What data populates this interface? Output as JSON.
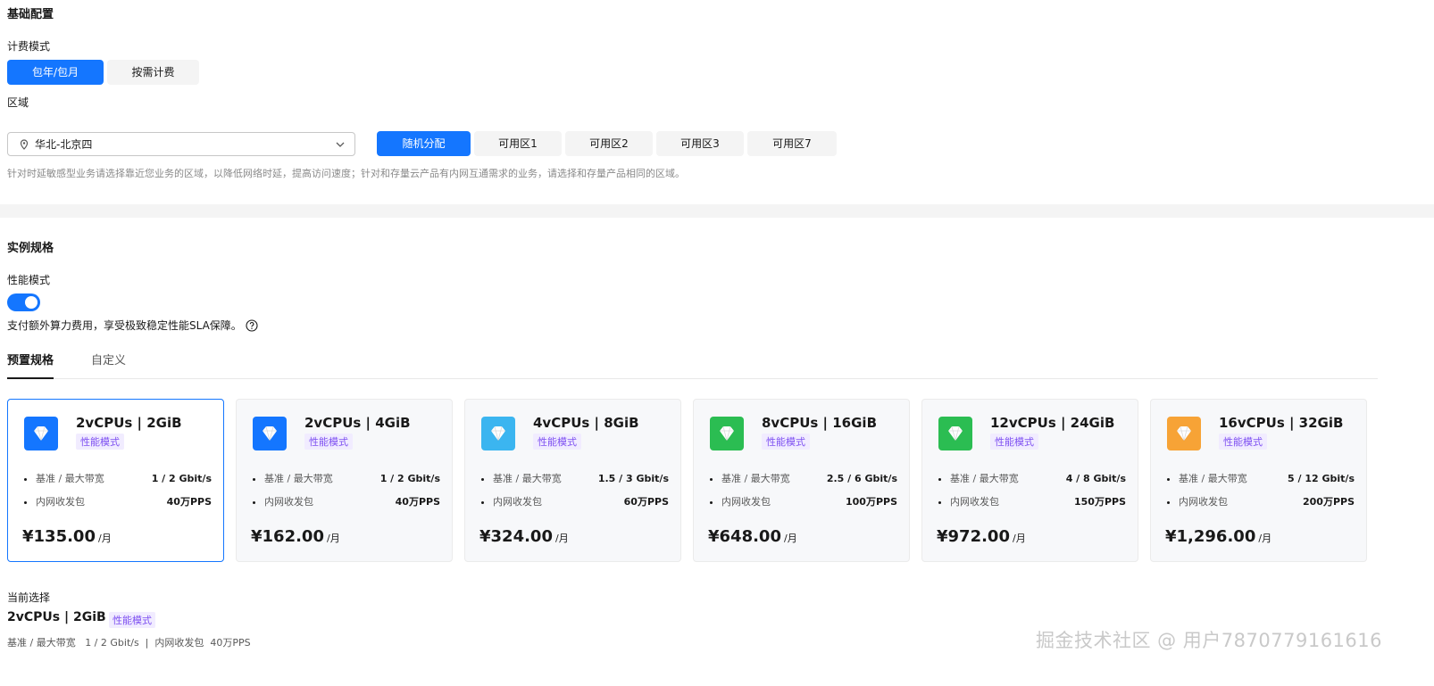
{
  "basic_config": {
    "title": "基础配置",
    "billing": {
      "label": "计费模式",
      "options": [
        "包年/包月",
        "按需计费"
      ],
      "selected": "包年/包月"
    },
    "region": {
      "label": "区域",
      "value": "华北-北京四",
      "pin_icon": "location-pin-icon",
      "dropdown_icon": "chevron-down-icon",
      "zones": [
        "随机分配",
        "可用区1",
        "可用区2",
        "可用区3",
        "可用区7"
      ],
      "selected_zone": "随机分配",
      "hint": "针对时延敏感型业务请选择靠近您业务的区域，以降低网络时延，提高访问速度；针对和存量云产品有内网互通需求的业务，请选择和存量产品相同的区域。"
    }
  },
  "instance_spec": {
    "title": "实例规格",
    "performance": {
      "label": "性能模式",
      "enabled": true,
      "note": "支付额外算力费用，享受极致稳定性能SLA保障。",
      "help_icon": "question-circle-icon"
    },
    "tabs": [
      "预置规格",
      "自定义"
    ],
    "active_tab": "预置规格",
    "cards": [
      {
        "name": "2vCPUs | 2GiB",
        "badge": "性能模式",
        "icon_color": "#1476ff",
        "spec1_label": "基准 / 最大带宽",
        "spec1_value": "1 / 2 Gbit/s",
        "spec2_label": "内网收发包",
        "spec2_value": "40万PPS",
        "price": "¥135.00",
        "unit": "/月",
        "selected": true
      },
      {
        "name": "2vCPUs | 4GiB",
        "badge": "性能模式",
        "icon_color": "#1476ff",
        "spec1_label": "基准 / 最大带宽",
        "spec1_value": "1 / 2 Gbit/s",
        "spec2_label": "内网收发包",
        "spec2_value": "40万PPS",
        "price": "¥162.00",
        "unit": "/月",
        "selected": false
      },
      {
        "name": "4vCPUs | 8GiB",
        "badge": "性能模式",
        "icon_color": "#3bb5f0",
        "spec1_label": "基准 / 最大带宽",
        "spec1_value": "1.5 / 3 Gbit/s",
        "spec2_label": "内网收发包",
        "spec2_value": "60万PPS",
        "price": "¥324.00",
        "unit": "/月",
        "selected": false
      },
      {
        "name": "8vCPUs | 16GiB",
        "badge": "性能模式",
        "icon_color": "#2bbd52",
        "spec1_label": "基准 / 最大带宽",
        "spec1_value": "2.5 / 6 Gbit/s",
        "spec2_label": "内网收发包",
        "spec2_value": "100万PPS",
        "price": "¥648.00",
        "unit": "/月",
        "selected": false
      },
      {
        "name": "12vCPUs | 24GiB",
        "badge": "性能模式",
        "icon_color": "#2bbd52",
        "spec1_label": "基准 / 最大带宽",
        "spec1_value": "4 / 8 Gbit/s",
        "spec2_label": "内网收发包",
        "spec2_value": "150万PPS",
        "price": "¥972.00",
        "unit": "/月",
        "selected": false
      },
      {
        "name": "16vCPUs | 32GiB",
        "badge": "性能模式",
        "icon_color": "#f7a336",
        "spec1_label": "基准 / 最大带宽",
        "spec1_value": "5 / 12 Gbit/s",
        "spec2_label": "内网收发包",
        "spec2_value": "200万PPS",
        "price": "¥1,296.00",
        "unit": "/月",
        "selected": false
      }
    ],
    "card_icon": "diamond-icon",
    "current": {
      "label": "当前选择",
      "name": "2vCPUs | 2GiB",
      "badge": "性能模式",
      "detail": "基准 / 最大带宽   1 / 2 Gbit/s  |  内网收发包  40万PPS"
    }
  },
  "watermark": "掘金技术社区 @ 用户7870779161616",
  "colors": {
    "accent": "#1476ff",
    "badge_text": "#7d4ff1",
    "badge_bg": "#f1ecff"
  }
}
